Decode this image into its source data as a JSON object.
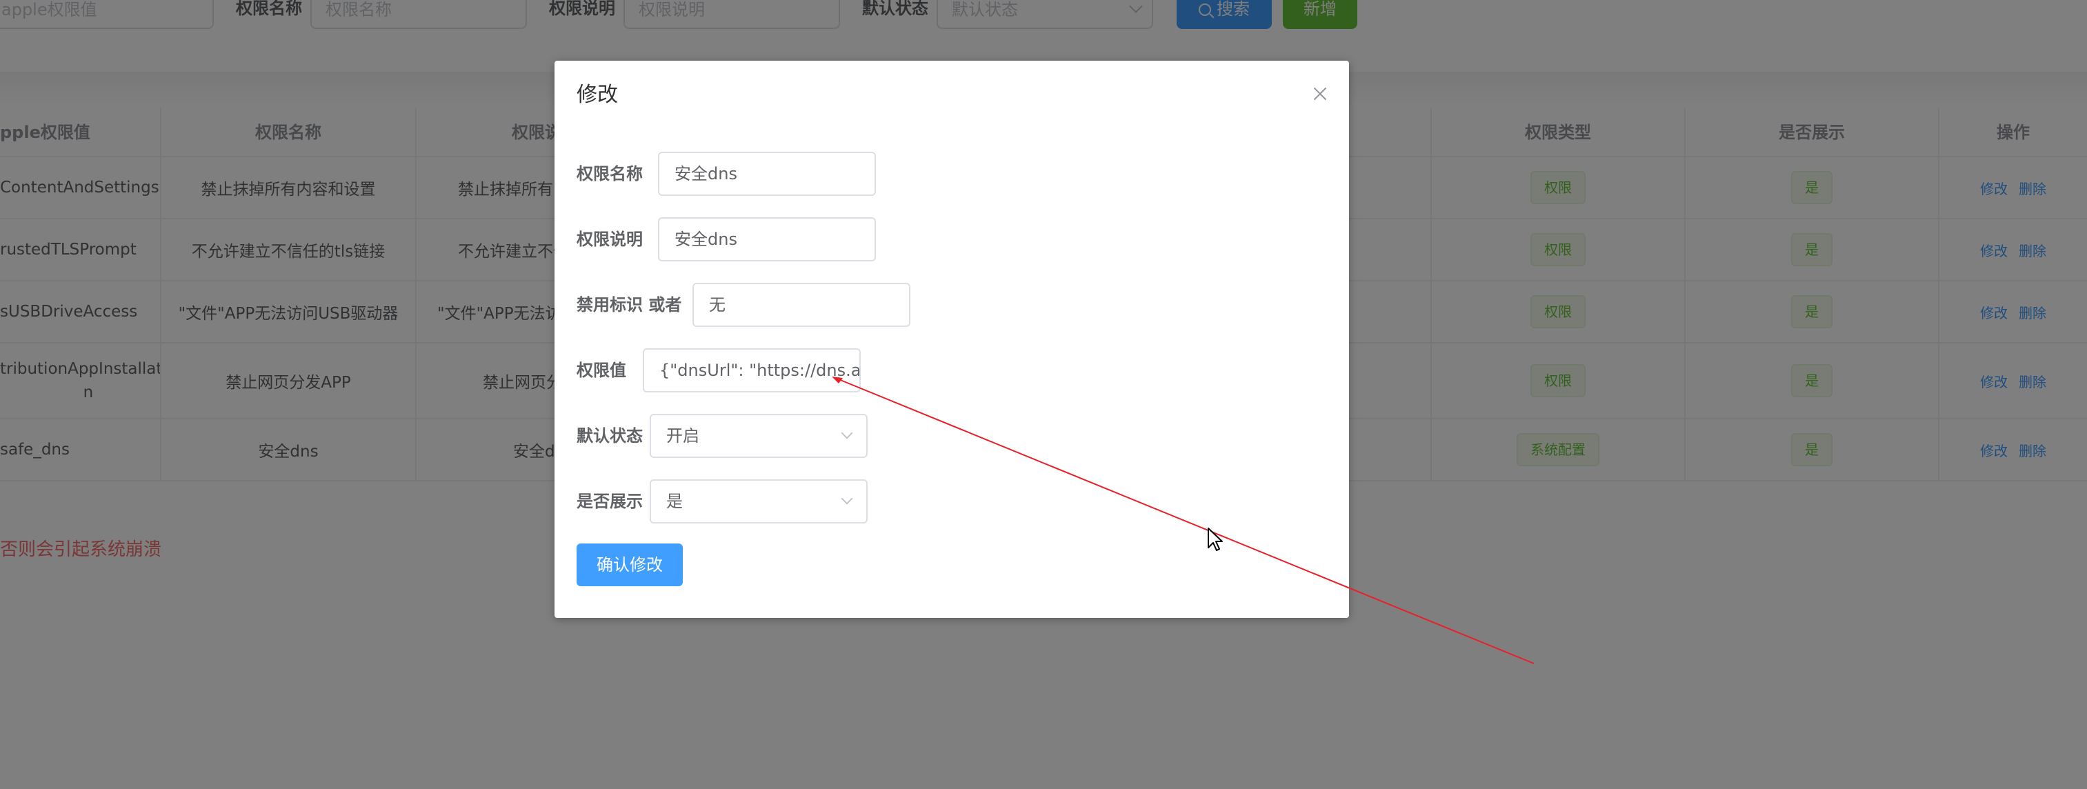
{
  "filters": {
    "apple_value_placeholder": "apple权限值",
    "name_label": "权限名称",
    "name_placeholder": "权限名称",
    "desc_label": "权限说明",
    "desc_placeholder": "权限说明",
    "status_label": "默认状态",
    "status_placeholder": "默认状态",
    "search_button": "搜索",
    "add_button": "新增"
  },
  "table": {
    "headers": {
      "apple_value": "pple权限值",
      "name": "权限名称",
      "desc": "权限说",
      "type": "权限类型",
      "show": "是否展示",
      "ops": "操作"
    },
    "rows": [
      {
        "apple_value": "ContentAndSettings",
        "name": "禁止抹掉所有内容和设置",
        "desc": "禁止抹掉所有",
        "type": "权限",
        "show": "是",
        "edit": "修改",
        "delete": "删除"
      },
      {
        "apple_value": "rustedTLSPrompt",
        "name": "不允许建立不信任的tls链接",
        "desc": "不允许建立不信",
        "type": "权限",
        "show": "是",
        "edit": "修改",
        "delete": "删除"
      },
      {
        "apple_value": "sUSBDriveAccess",
        "name": "\"文件\"APP无法访问USB驱动器",
        "desc": "\"文件\"APP无法访",
        "type": "权限",
        "show": "是",
        "edit": "修改",
        "delete": "删除"
      },
      {
        "apple_value": "tributionAppInstallatio",
        "apple_value_2": "n",
        "name": "禁止网页分发APP",
        "desc": "禁止网页分",
        "type": "权限",
        "show": "是",
        "edit": "修改",
        "delete": "删除"
      },
      {
        "apple_value": "safe_dns",
        "name": "安全dns",
        "desc": "安全d",
        "type": "系统配置",
        "show": "是",
        "edit": "修改",
        "delete": "删除"
      }
    ]
  },
  "warning_text": "否则会引起系统崩溃",
  "dialog": {
    "title": "修改",
    "fields": {
      "name_label": "权限名称",
      "name_value": "安全dns",
      "desc_label": "权限说明",
      "desc_value": "安全dns",
      "flag_label": "禁用标识 或者",
      "flag_value": "无",
      "value_label": "权限值",
      "value_value": "{\"dnsUrl\": \"https://dns.alic",
      "status_label": "默认状态",
      "status_value": "开启",
      "show_label": "是否展示",
      "show_value": "是"
    },
    "confirm_button": "确认修改"
  },
  "colors": {
    "primary": "#409eff",
    "success": "#67c23a",
    "danger": "#f56c6c",
    "annotation": "#e8202a"
  }
}
